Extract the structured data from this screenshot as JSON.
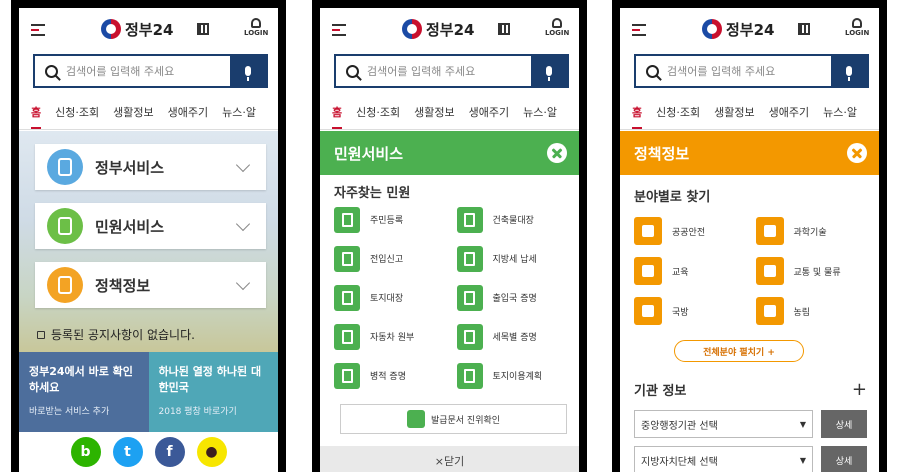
{
  "header": {
    "logo_text": "정부24",
    "login_label": "LOGIN"
  },
  "search": {
    "placeholder": "검색어를 입력해 주세요"
  },
  "tabs": [
    "홈",
    "신청·조회",
    "생활정보",
    "생애주기",
    "뉴스·알"
  ],
  "screen1": {
    "cards": [
      {
        "label": "정부서비스",
        "icon": "hand-touch-icon",
        "color": "#5aa9e0"
      },
      {
        "label": "민원서비스",
        "icon": "chat-phone-icon",
        "color": "#6cbf47"
      },
      {
        "label": "정책정보",
        "icon": "phone-ring-icon",
        "color": "#f3a324"
      }
    ],
    "notice": "등록된 공지사항이 없습니다.",
    "promos": [
      {
        "title": "정부24에서 바로 확인하세요",
        "sub": "바로받는 서비스 추가"
      },
      {
        "title": "하나된 열정 하나된 대한민국",
        "sub": "2018 평창 바로가기"
      }
    ],
    "social": [
      {
        "name": "band-icon",
        "glyph": "b",
        "color": "#2db400"
      },
      {
        "name": "twitter-icon",
        "glyph": "t",
        "color": "#1da1f2"
      },
      {
        "name": "facebook-icon",
        "glyph": "f",
        "color": "#3b5998"
      },
      {
        "name": "kakaotalk-icon",
        "glyph": "●",
        "color": "#f7e600"
      }
    ]
  },
  "screen2": {
    "panel_title": "민원서비스",
    "section_title": "자주찾는 민원",
    "services": [
      "주민등록",
      "건축물대장",
      "전입신고",
      "지방세 납세",
      "토지대장",
      "출입국 증명",
      "자동차 원부",
      "세목별 증명",
      "병적 증명",
      "토지이용계획"
    ],
    "verify_label": "발급문서 진위확인",
    "close_label": "×닫기"
  },
  "screen3": {
    "panel_title": "정책정보",
    "section_title": "분야별로 찾기",
    "fields": [
      "공공안전",
      "과학기술",
      "교육",
      "교통 및 물류",
      "국방",
      "농림"
    ],
    "expand_label": "전체분야 펼치기 +",
    "org_title": "기관 정보",
    "plus": "+",
    "selects": [
      {
        "label": "중앙행정기관 선택",
        "button": "상세"
      },
      {
        "label": "지방자치단체 선택",
        "button": "상세"
      }
    ]
  },
  "colors": {
    "accent_red": "#c8102e",
    "navy": "#1a3d6d",
    "green": "#4cb050",
    "orange": "#f39800"
  }
}
